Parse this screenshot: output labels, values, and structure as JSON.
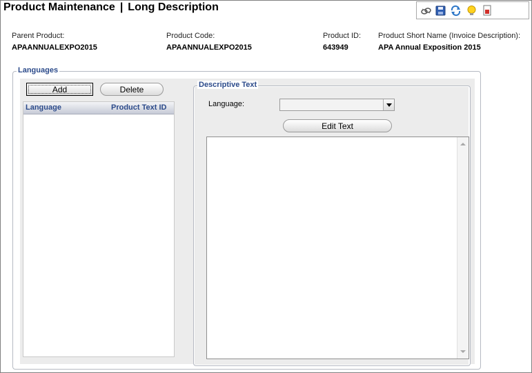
{
  "header": {
    "title_main": "Product Maintenance",
    "title_separator": "|",
    "title_sub": "Long Description"
  },
  "toolbar": {
    "icons": [
      "view-icon",
      "save-icon",
      "refresh-icon",
      "help-bulb-icon",
      "report-icon"
    ]
  },
  "product_info": {
    "parent_product": {
      "label": "Parent Product:",
      "value": "APAANNUALEXPO2015"
    },
    "product_code": {
      "label": "Product Code:",
      "value": "APAANNUALEXPO2015"
    },
    "product_id": {
      "label": "Product ID:",
      "value": "643949"
    },
    "short_name": {
      "label": "Product Short Name (Invoice Description):",
      "value": "APA Annual Exposition 2015"
    }
  },
  "languages": {
    "legend": "Languages",
    "add_label": "Add",
    "delete_label": "Delete",
    "columns": [
      "Language",
      "Product Text ID"
    ],
    "rows": []
  },
  "descriptive_text": {
    "legend": "Descriptive Text",
    "language_label": "Language:",
    "language_value": "",
    "edit_label": "Edit Text",
    "text": ""
  },
  "colors": {
    "legend_blue": "#2b4a8a",
    "panel_bg": "#ececec"
  }
}
